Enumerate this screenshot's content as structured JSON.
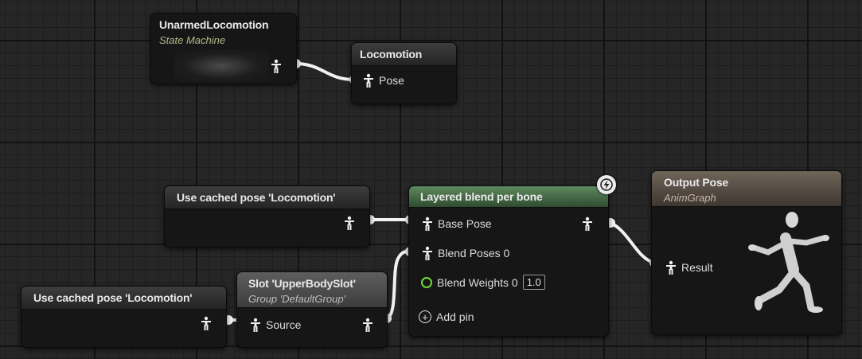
{
  "nodes": {
    "unarmed_locomotion": {
      "title": "UnarmedLocomotion",
      "subtitle": "State Machine"
    },
    "locomotion_output": {
      "title": "Locomotion",
      "pin": "Pose"
    },
    "cached_pose_top": {
      "title": "Use cached pose 'Locomotion'"
    },
    "cached_pose_bottom": {
      "title": "Use cached pose 'Locomotion'"
    },
    "slot": {
      "title": "Slot 'UpperBodySlot'",
      "subtitle": "Group 'DefaultGroup'",
      "pin": "Source"
    },
    "layered_blend": {
      "title": "Layered blend per bone",
      "pins": [
        "Base Pose",
        "Blend Poses 0",
        "Blend Weights 0"
      ],
      "weight_value": "1.0",
      "add_pin": "Add pin"
    },
    "output_pose": {
      "title": "Output Pose",
      "subtitle": "AnimGraph",
      "pin": "Result"
    }
  },
  "icons": {
    "pose_pin": "pose-person-icon",
    "bool_pin": "green-circle-pin-icon",
    "add": "plus-circle-icon",
    "fast_path": "lightning-bolt-icon",
    "preview": "running-mannequin-icon"
  },
  "colors": {
    "grid_bg": "#262626",
    "node_bg": "#161616",
    "wire": "#f2f2f2",
    "blend_header": "#5f8a5f",
    "output_header": "#6f6559",
    "bool_pin": "#6bdc3a"
  }
}
